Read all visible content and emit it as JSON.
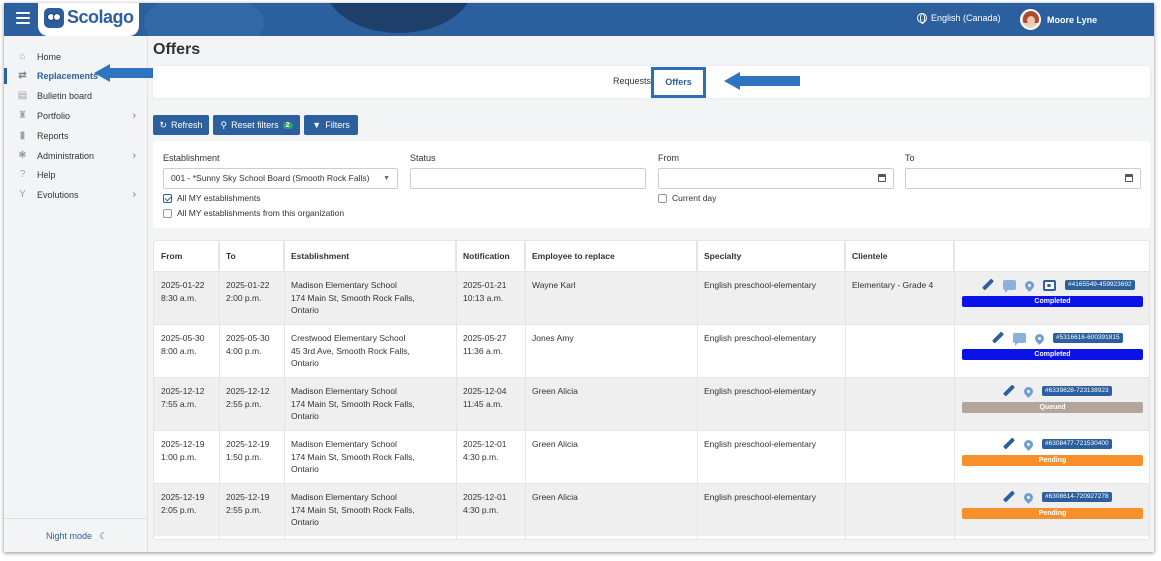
{
  "app": {
    "logo_text": "Scolago",
    "language": "English (Canada)",
    "user_name": "Moore Lyne"
  },
  "sidebar": {
    "items": [
      {
        "label": "Home",
        "icon": "home-icon"
      },
      {
        "label": "Replacements",
        "icon": "replacements-icon",
        "active": true
      },
      {
        "label": "Bulletin board",
        "icon": "bulletin-icon"
      },
      {
        "label": "Portfolio",
        "icon": "trophy-icon",
        "has_children": true
      },
      {
        "label": "Reports",
        "icon": "report-icon"
      },
      {
        "label": "Administration",
        "icon": "gear-icon",
        "has_children": true
      },
      {
        "label": "Help",
        "icon": "help-icon"
      },
      {
        "label": "Evolutions",
        "icon": "evolution-icon",
        "has_children": true
      }
    ],
    "night_mode": "Night mode"
  },
  "page": {
    "title": "Offers",
    "tabs": {
      "requests": "Requests",
      "offers": "Offers"
    }
  },
  "toolbar": {
    "refresh": "Refresh",
    "reset_filters": "Reset filters",
    "reset_count": "2",
    "filters": "Filters"
  },
  "filters": {
    "establishment_label": "Establishment",
    "establishment_value": "001 - *Sunny Sky School Board (Smooth Rock Falls)",
    "status_label": "Status",
    "status_value": "",
    "from_label": "From",
    "from_value": "",
    "to_label": "To",
    "to_value": "",
    "all_my_establishments": "All MY establishments",
    "all_my_establishments_checked": true,
    "all_my_from_org": "All MY establishments from this organization",
    "all_my_from_org_checked": false,
    "current_day": "Current day",
    "current_day_checked": false
  },
  "table": {
    "headers": [
      "From",
      "To",
      "Establishment",
      "Notification",
      "Employee to replace",
      "Specialty",
      "Clientele",
      ""
    ],
    "rows": [
      {
        "from_date": "2025-01-22",
        "from_time": "8:30 a.m.",
        "to_date": "2025-01-22",
        "to_time": "2:00 p.m.",
        "est_name": "Madison Elementary School",
        "est_addr1": "174 Main St, Smooth Rock Falls,",
        "est_addr2": "Ontario",
        "notif_date": "2025-01-21",
        "notif_time": "10:13 a.m.",
        "employee": "Wayne Karl",
        "specialty": "English preschool-elementary",
        "clientele": "Elementary - Grade 4",
        "id": "#4165549-459923692",
        "status": "Completed",
        "status_color": "#0a12e8",
        "icons": [
          "pencil-icon",
          "comment-icon",
          "pin-icon",
          "photo-icon"
        ]
      },
      {
        "from_date": "2025-05-30",
        "from_time": "8:00 a.m.",
        "to_date": "2025-05-30",
        "to_time": "4:00 p.m.",
        "est_name": "Crestwood Elementary School",
        "est_addr1": "45 3rd Ave, Smooth Rock Falls,",
        "est_addr2": "Ontario",
        "notif_date": "2025-05-27",
        "notif_time": "11:36 a.m.",
        "employee": "Jones Amy",
        "specialty": "English preschool-elementary",
        "clientele": "",
        "id": "#5316616-600391815",
        "status": "Completed",
        "status_color": "#0a12e8",
        "icons": [
          "pencil-icon",
          "comment-icon",
          "pin-icon"
        ]
      },
      {
        "from_date": "2025-12-12",
        "from_time": "7:55 a.m.",
        "to_date": "2025-12-12",
        "to_time": "2:55 p.m.",
        "est_name": "Madison Elementary School",
        "est_addr1": "174 Main St, Smooth Rock Falls,",
        "est_addr2": "Ontario",
        "notif_date": "2025-12-04",
        "notif_time": "11:45 a.m.",
        "employee": "Green Alicia",
        "specialty": "English preschool-elementary",
        "clientele": "",
        "id": "#6339828-723138923",
        "status": "Queued",
        "status_color": "#b3a59a",
        "icons": [
          "pencil-icon",
          "pin-icon"
        ]
      },
      {
        "from_date": "2025-12-19",
        "from_time": "1:00 p.m.",
        "to_date": "2025-12-19",
        "to_time": "1:50 p.m.",
        "est_name": "Madison Elementary School",
        "est_addr1": "174 Main St, Smooth Rock Falls,",
        "est_addr2": "Ontario",
        "notif_date": "2025-12-01",
        "notif_time": "4:30 p.m.",
        "employee": "Green Alicia",
        "specialty": "English preschool-elementary",
        "clientele": "",
        "id": "#6308477-721530400",
        "status": "Pending",
        "status_color": "#f7902b",
        "icons": [
          "pencil-icon",
          "pin-icon"
        ]
      },
      {
        "from_date": "2025-12-19",
        "from_time": "2:05 p.m.",
        "to_date": "2025-12-19",
        "to_time": "2:55 p.m.",
        "est_name": "Madison Elementary School",
        "est_addr1": "174 Main St, Smooth Rock Falls,",
        "est_addr2": "Ontario",
        "notif_date": "2025-12-01",
        "notif_time": "4:30 p.m.",
        "employee": "Green Alicia",
        "specialty": "English preschool-elementary",
        "clientele": "",
        "id": "#6308614-720927278",
        "status": "Pending",
        "status_color": "#f7902b",
        "icons": [
          "pencil-icon",
          "pin-icon"
        ]
      }
    ]
  },
  "colors": {
    "brand": "#2b5f9d",
    "annotation_arrow": "#2f74c0"
  }
}
